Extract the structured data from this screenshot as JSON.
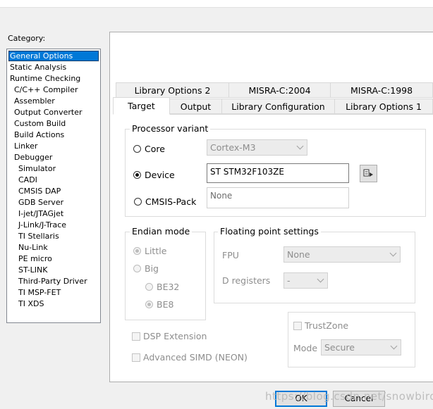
{
  "sidebar": {
    "label": "Category:",
    "items": [
      {
        "label": "General Options",
        "selected": true
      },
      {
        "label": "Static Analysis"
      },
      {
        "label": "Runtime Checking"
      },
      {
        "label": "C/C++ Compiler"
      },
      {
        "label": "Assembler"
      },
      {
        "label": "Output Converter"
      },
      {
        "label": "Custom Build"
      },
      {
        "label": "Build Actions"
      },
      {
        "label": "Linker"
      },
      {
        "label": "Debugger"
      },
      {
        "label": "Simulator"
      },
      {
        "label": "CADI"
      },
      {
        "label": "CMSIS DAP"
      },
      {
        "label": "GDB Server"
      },
      {
        "label": "I-jet/JTAGjet"
      },
      {
        "label": "J-Link/J-Trace"
      },
      {
        "label": "TI Stellaris"
      },
      {
        "label": "Nu-Link"
      },
      {
        "label": "PE micro"
      },
      {
        "label": "ST-LINK"
      },
      {
        "label": "Third-Party Driver"
      },
      {
        "label": "TI MSP-FET"
      },
      {
        "label": "TI XDS"
      }
    ]
  },
  "tabs": {
    "row1": [
      "Library Options 2",
      "MISRA-C:2004",
      "MISRA-C:1998"
    ],
    "row2": [
      "Target",
      "Output",
      "Library Configuration",
      "Library Options 1"
    ],
    "active": "Target"
  },
  "processor": {
    "legend": "Processor variant",
    "core_label": "Core",
    "core_value": "Cortex-M3",
    "device_label": "Device",
    "device_value": "ST STM32F103ZE",
    "cmsis_label": "CMSIS-Pack",
    "cmsis_value": "None"
  },
  "endian": {
    "legend": "Endian mode",
    "little": "Little",
    "big": "Big",
    "be32": "BE32",
    "be8": "BE8"
  },
  "floating": {
    "legend": "Floating point settings",
    "fpu_label": "FPU",
    "fpu_value": "None",
    "dreg_label": "D registers",
    "dreg_value": "-"
  },
  "extensions": {
    "dsp": "DSP Extension",
    "simd": "Advanced SIMD (NEON)"
  },
  "trustzone": {
    "label": "TrustZone",
    "mode_label": "Mode",
    "mode_value": "Secure"
  },
  "footer": {
    "ok": "OK",
    "cancel": "Cancel",
    "watermark": "https://blog.csdn.net/snowbird13"
  }
}
